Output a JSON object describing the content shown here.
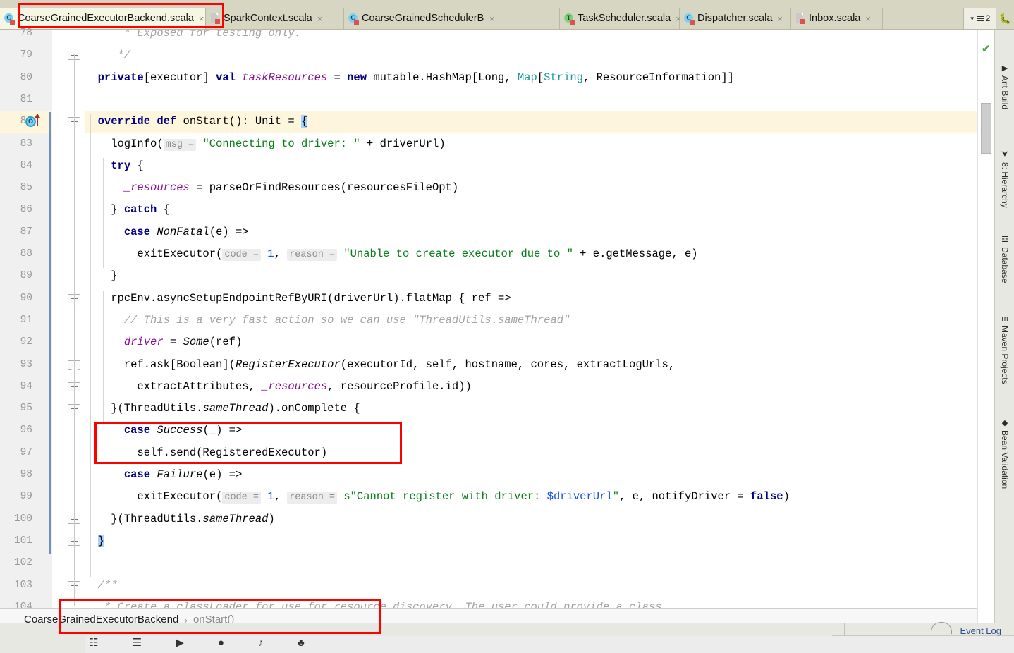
{
  "window": {
    "app": "IntelliJ IDEA",
    "active_file": "CoarseGrainedExecutorBackend.scala"
  },
  "tabs": {
    "extra_count": "2",
    "items": [
      {
        "label": "CoarseGrainedExecutorBackend.scala",
        "icon": "scala-class-icon",
        "active": true,
        "close": "×"
      },
      {
        "label": "SparkContext.scala",
        "icon": "scala-file-icon",
        "active": false,
        "close": "×"
      },
      {
        "label": "CoarseGrainedSchedulerBackend.scala",
        "icon": "scala-class-icon",
        "active": false,
        "close": "×"
      },
      {
        "label": "TaskScheduler.scala",
        "icon": "scala-trait-icon",
        "active": false,
        "close": "×"
      },
      {
        "label": "Dispatcher.scala",
        "icon": "scala-class-icon",
        "active": false,
        "close": "×"
      },
      {
        "label": "Inbox.scala",
        "icon": "scala-file-icon",
        "active": false,
        "close": "×"
      }
    ]
  },
  "editor": {
    "first_line": 78,
    "caret_line": 82,
    "lines": [
      {
        "n": 78,
        "html": "      <span class='cmt'>* Exposed for testing only.</span>"
      },
      {
        "n": 79,
        "html": "     <span class='cmt'>*/</span>"
      },
      {
        "n": 80,
        "html": "  <span class='kw'>private</span>[executor] <span class='kw'>val</span> <span class='fld'>taskResources</span> = <span class='kw'>new</span> mutable.HashMap[Long, <span class='typ'>Map</span>[<span class='typ'>String</span>, ResourceInformation]]"
      },
      {
        "n": 81,
        "html": ""
      },
      {
        "n": 82,
        "html": "  <span class='kw'>override</span> <span class='kw'>def</span> onStart(): Unit = <span class='sel'>{</span>"
      },
      {
        "n": 83,
        "html": "    logInfo(<span class='hint'>msg =</span> <span class='str'>\"Connecting to driver: \"</span> + driverUrl)"
      },
      {
        "n": 84,
        "html": "    <span class='kw'>try</span> {"
      },
      {
        "n": 85,
        "html": "      <span class='fld'>_resources</span> = parseOrFindResources(resourcesFileOpt)"
      },
      {
        "n": 86,
        "html": "    } <span class='kw'>catch</span> {"
      },
      {
        "n": 87,
        "html": "      <span class='kw'>case</span> <span class='cls2'>NonFatal</span>(e) =&gt;"
      },
      {
        "n": 88,
        "html": "        exitExecutor(<span class='hint'>code =</span> <span class='num'>1</span>, <span class='hint'>reason =</span> <span class='str'>\"Unable to create executor due to \"</span> + e.getMessage, e)"
      },
      {
        "n": 89,
        "html": "    }"
      },
      {
        "n": 90,
        "html": "    rpcEnv.asyncSetupEndpointRefByURI(driverUrl).flatMap { ref =&gt;"
      },
      {
        "n": 91,
        "html": "      <span class='cmt'>// This is a very fast action so we can use \"ThreadUtils.sameThread\"</span>"
      },
      {
        "n": 92,
        "html": "      <span class='fld'>driver</span> = <span class='cls2'>Some</span>(ref)"
      },
      {
        "n": 93,
        "html": "      ref.ask[Boolean](<span class='cls2'>RegisterExecutor</span>(executorId, self, hostname, cores, extractLogUrls,"
      },
      {
        "n": 94,
        "html": "        extractAttributes, <span class='fld'>_resources</span>, resourceProfile.id))"
      },
      {
        "n": 95,
        "html": "    }(ThreadUtils.<span class='cls2'>sameThread</span>).onComplete {"
      },
      {
        "n": 96,
        "html": "      <span class='kw'>case</span> <span class='cls2'>Success</span>(_) =&gt;"
      },
      {
        "n": 97,
        "html": "        self.send(RegisteredExecutor)"
      },
      {
        "n": 98,
        "html": "      <span class='kw'>case</span> <span class='cls2'>Failure</span>(e) =&gt;"
      },
      {
        "n": 99,
        "html": "        exitExecutor(<span class='hint'>code =</span> <span class='num'>1</span>, <span class='hint'>reason =</span> <span class='str'>s\"Cannot register with driver: </span><span class='interp'>$driverUrl</span><span class='str'>\"</span>, e, notifyDriver = <span class='kw'>false</span>)"
      },
      {
        "n": 100,
        "html": "    }(ThreadUtils.<span class='cls2'>sameThread</span>)"
      },
      {
        "n": 101,
        "html": "  <span class='sel'>}</span>"
      },
      {
        "n": 102,
        "html": ""
      },
      {
        "n": 103,
        "html": "  <span class='cmt'>/**</span>"
      },
      {
        "n": 104,
        "html": "   <span class='cmt'>* Create a classLoader for use for resource discovery. The user could provide a class</span>"
      }
    ]
  },
  "breadcrumb": {
    "class": "CoarseGrainedExecutorBackend",
    "separator": "›",
    "method": "onStart()"
  },
  "right_toolstrip": {
    "items": [
      {
        "label": "Ant Build",
        "icon": "ant-icon"
      },
      {
        "label": "8: Hierarchy",
        "icon": "hierarchy-icon"
      },
      {
        "label": "Database",
        "icon": "database-icon"
      },
      {
        "label": "Maven Projects",
        "icon": "maven-icon"
      },
      {
        "label": "Bean Validation",
        "icon": "bean-icon"
      }
    ]
  },
  "status": {
    "event_log": "Event Log",
    "inspection_ok": "✔"
  },
  "colors": {
    "tab_bar": "#d6d6c2",
    "active_tab": "#f6f6e4",
    "editor_bg": "#ffffff",
    "caret_line": "#fdf6dd",
    "keyword": "#000080",
    "string": "#067d17",
    "comment": "#a3a3a3",
    "field": "#871094",
    "number": "#1750eb",
    "type": "#20999d",
    "annotation_red": "#ff0000",
    "selection": "#a6d2ff"
  }
}
